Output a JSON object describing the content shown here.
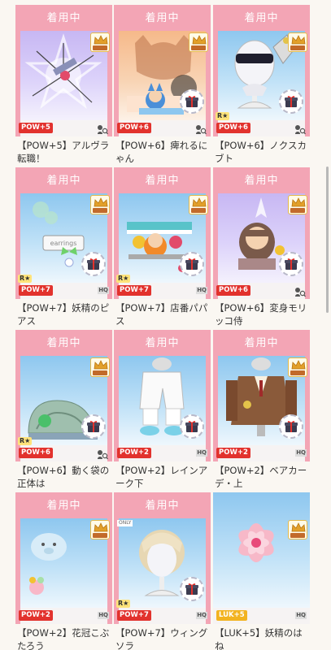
{
  "equipped_label": "着用中",
  "items": [
    {
      "caption": "【POW+5】アルヴラ転職！",
      "stat": "POW+5",
      "stat_type": "pow",
      "bg": "purple",
      "banner": true,
      "crown": true,
      "gift": false,
      "rarity": "",
      "hq": false,
      "only": false,
      "art": "magic"
    },
    {
      "caption": "【POW+6】痺れるにゃん",
      "stat": "POW+6",
      "stat_type": "pow",
      "bg": "orange",
      "banner": true,
      "crown": true,
      "gift": true,
      "rarity": "",
      "hq": false,
      "only": false,
      "art": "cat"
    },
    {
      "caption": "【POW+6】ノクスカブト",
      "stat": "POW+6",
      "stat_type": "pow",
      "bg": "blue",
      "banner": true,
      "crown": true,
      "gift": true,
      "rarity": "R★",
      "hq": false,
      "only": false,
      "art": "helmet"
    },
    {
      "caption": "【POW+7】妖精のピアス",
      "stat": "POW+7",
      "stat_type": "pow",
      "bg": "blue",
      "banner": true,
      "crown": true,
      "gift": true,
      "rarity": "R★",
      "hq": true,
      "only": false,
      "art": "earring"
    },
    {
      "caption": "【POW+7】店番パパス",
      "stat": "POW+7",
      "stat_type": "pow",
      "bg": "blue",
      "banner": true,
      "crown": true,
      "gift": true,
      "rarity": "R★",
      "hq": true,
      "only": false,
      "art": "shop"
    },
    {
      "caption": "【POW+6】変身モリッコ侍",
      "stat": "POW+6",
      "stat_type": "pow",
      "bg": "purple",
      "banner": true,
      "crown": true,
      "gift": true,
      "rarity": "",
      "hq": false,
      "only": false,
      "art": "samurai"
    },
    {
      "caption": "【POW+6】動く袋の正体は",
      "stat": "POW+6",
      "stat_type": "pow",
      "bg": "blue",
      "banner": true,
      "crown": true,
      "gift": true,
      "rarity": "R★",
      "hq": false,
      "only": false,
      "art": "bag"
    },
    {
      "caption": "【POW+2】レインアーク下",
      "stat": "POW+2",
      "stat_type": "pow",
      "bg": "blue",
      "banner": true,
      "crown": false,
      "gift": true,
      "rarity": "",
      "hq": true,
      "only": false,
      "art": "pants"
    },
    {
      "caption": "【POW+2】ベアカーデ・上",
      "stat": "POW+2",
      "stat_type": "pow",
      "bg": "blue",
      "banner": true,
      "crown": true,
      "gift": true,
      "rarity": "",
      "hq": true,
      "only": false,
      "art": "cardigan"
    },
    {
      "caption": "【POW+2】花冠こぶたろう",
      "stat": "POW+2",
      "stat_type": "pow",
      "bg": "blue",
      "banner": true,
      "crown": true,
      "gift": false,
      "rarity": "",
      "hq": true,
      "only": false,
      "art": "pig"
    },
    {
      "caption": "【POW+7】ウィングソラ",
      "stat": "POW+7",
      "stat_type": "pow",
      "bg": "blue",
      "banner": true,
      "crown": false,
      "gift": true,
      "rarity": "R★",
      "hq": true,
      "only": true,
      "art": "hair"
    },
    {
      "caption": "【LUK+5】妖精のはね",
      "stat": "LUK+5",
      "stat_type": "luk",
      "bg": "blue",
      "banner": false,
      "crown": true,
      "gift": false,
      "rarity": "",
      "hq": true,
      "only": false,
      "art": "flower"
    }
  ],
  "only_label": "ONLY",
  "hq_label": "HQ",
  "crown_label": "CHOCO"
}
